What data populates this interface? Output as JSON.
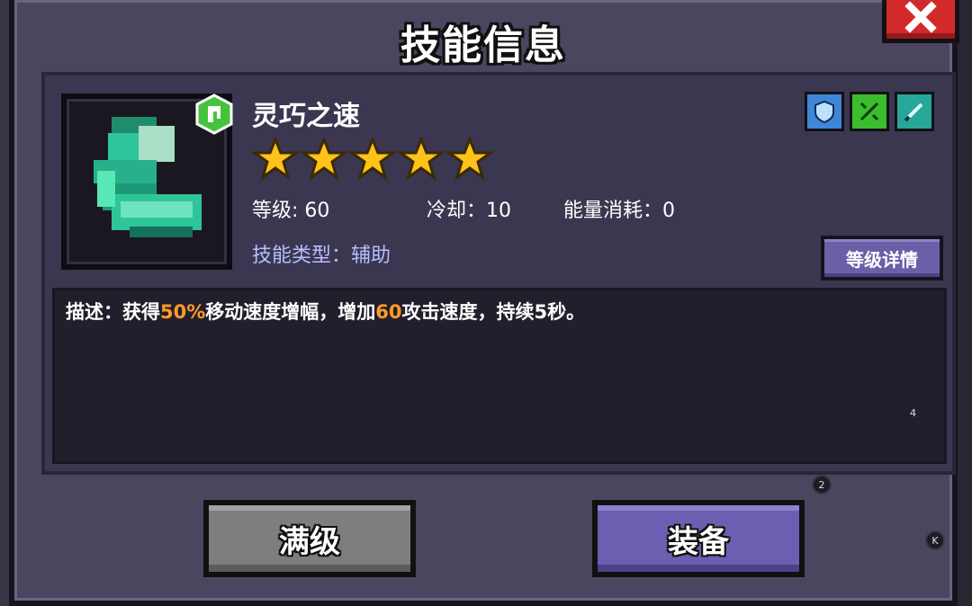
{
  "dialog": {
    "title": "技能信息"
  },
  "skill": {
    "name": "灵巧之速",
    "stars": 5,
    "level": "等级: 60",
    "cooldown": "冷却：10",
    "energy_cost": "能量消耗：0",
    "type": "技能类型：辅助",
    "level_detail_label": "等级详情",
    "description": {
      "prefix": "描述：获得",
      "value1": "50%",
      "mid": "移动速度增幅，增加",
      "value2": "60",
      "suffix": "攻击速度，持续5秒。"
    },
    "corner_number": "4"
  },
  "element_icons": [
    "shield-icon",
    "sword-icon",
    "blade-icon"
  ],
  "buttons": {
    "max_level": "满级",
    "equip": "装备"
  },
  "markers": {
    "m1": "2",
    "m2": "K"
  },
  "colors": {
    "highlight": "#ff9a2a",
    "skill_type": "#b8bfff",
    "close": "#d22a2a",
    "equip": "#6a5fb0",
    "max": "#7e7e80"
  }
}
